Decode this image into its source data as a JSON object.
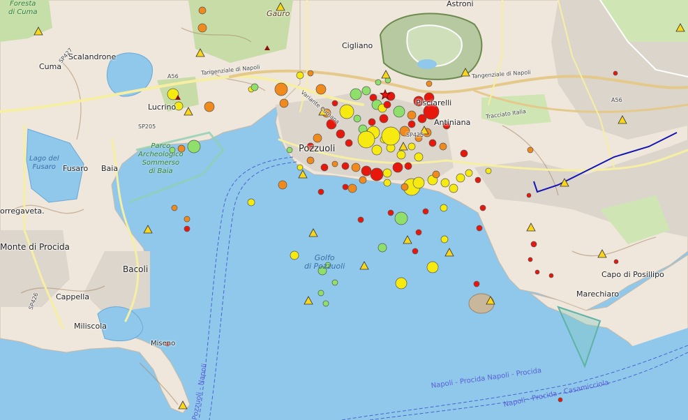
{
  "map": {
    "title": "",
    "colors": {
      "sea": "#8fc8ea",
      "land": "#f1ebe2",
      "urban": "#dcd6cf",
      "park": "#cfe6b4",
      "crater": "#b9c9a3",
      "road_major": "#f7f0a8",
      "road_highway": "#e7c58a",
      "event_red": "#e8170c",
      "event_orange": "#f08a1c",
      "event_yellow": "#f6ea10",
      "event_green": "#8ee06a",
      "triangle": "#f9d61c"
    },
    "places": {
      "pozzuoli": "Pozzuoli",
      "cigliano": "Cigliano",
      "astroni": "Astroni",
      "lucrino": "Lucrino",
      "cuma": "Cuma",
      "scalandrone": "Scalandrone",
      "fusaro": "Fusaro",
      "baia": "Baia",
      "bacoli": "Bacoli",
      "cappella": "Cappella",
      "miliscola": "Miliscola",
      "miseno": "Miseno",
      "monte_di_procida": "Monte di Procida",
      "torregaveta": "orregaveta.",
      "pisciarelli": "Pisciarelli",
      "agnano": "Antiniana",
      "marechiaro": "Marechiaro",
      "capo_posillipo": "Capo di Posillipo",
      "gauro": "Gauro",
      "foresta_cuma": "Foresta\ndi Cuma"
    },
    "water_labels": {
      "gulf": "Golfo\ndi Pozzuoli",
      "lago_fusaro": "Lago del\nFusaro"
    },
    "park_labels": {
      "parco_baia": "Parco\nArcheologico\nSommerso\ndi Baia"
    },
    "road_labels": {
      "tangenziale_1": "Tangenziale di Napoli",
      "tangenziale_2": "Tangenziale di Napoli",
      "a56_1": "A56",
      "a56_2": "A56",
      "sp205": "SP205",
      "sp425": "SP425",
      "sp427": "SP427",
      "sp426": "SP426",
      "variante": "Variante Cumana",
      "tracciato": "Tracciato Italia"
    },
    "ferry_labels": {
      "route1": "Napoli - Procida  Napoli - Procida",
      "route2": "Napoli - Procida - Casamicciola",
      "route3": "Pozzuoli - Napoli"
    }
  }
}
